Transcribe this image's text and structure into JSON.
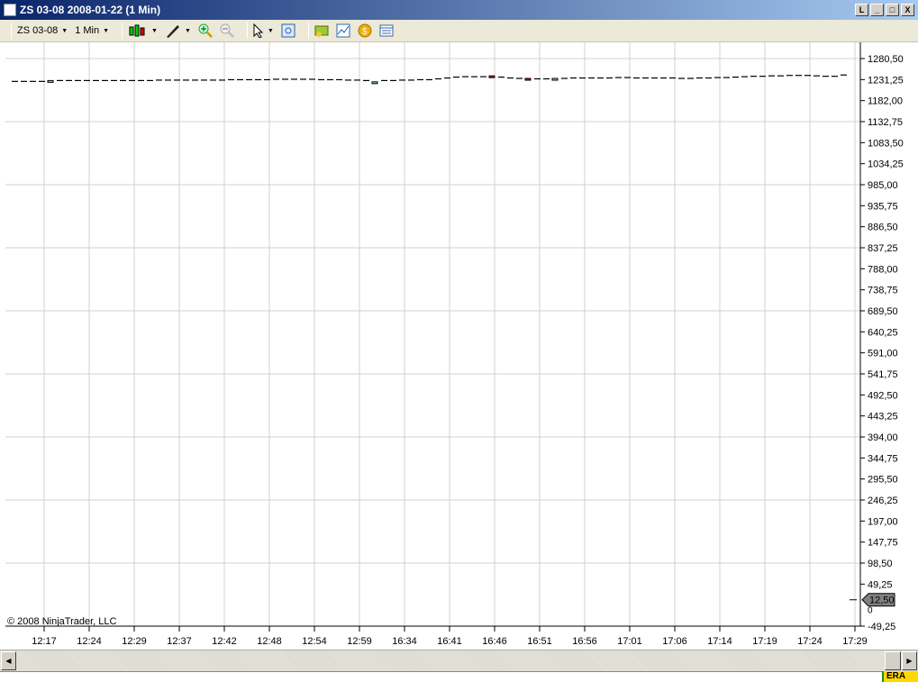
{
  "window": {
    "title": "ZS 03-08  2008-01-22  (1 Min)",
    "buttons": [
      "L",
      "_",
      "□",
      "X"
    ]
  },
  "toolbar": {
    "instrument": "ZS 03-08",
    "interval": "1 Min",
    "icons": [
      "chart-style-icon",
      "drawing-tool-icon",
      "zoom-in-icon",
      "zoom-out-icon",
      "pointer-icon",
      "data-box-icon",
      "indicators-icon",
      "strategies-icon",
      "orders-icon",
      "properties-icon"
    ]
  },
  "chart_data": {
    "type": "candlestick",
    "instrument": "ZS 03-08",
    "ylim": [
      -49.25,
      1280.5
    ],
    "y_ticks": [
      "1280,50",
      "1231,25",
      "1182,00",
      "1132,75",
      "1083,50",
      "1034,25",
      "985,00",
      "935,75",
      "886,50",
      "837,25",
      "788,00",
      "738,75",
      "689,50",
      "640,25",
      "591,00",
      "541,75",
      "492,50",
      "443,25",
      "394,00",
      "344,75",
      "295,50",
      "246,25",
      "197,00",
      "147,75",
      "98,50",
      "49,25",
      "0",
      "-49,25"
    ],
    "x_ticks": [
      "12:17",
      "12:24",
      "12:29",
      "12:37",
      "12:42",
      "12:48",
      "12:54",
      "12:59",
      "16:34",
      "16:41",
      "16:46",
      "16:51",
      "16:56",
      "17:01",
      "17:06",
      "17:14",
      "17:19",
      "17:24",
      "17:29"
    ],
    "closes": [
      1227,
      1227,
      1227,
      1227,
      1229,
      1229,
      1229,
      1229,
      1229,
      1229,
      1229,
      1229,
      1229,
      1229,
      1229,
      1229,
      1230,
      1230,
      1230,
      1230,
      1230,
      1230,
      1230,
      1230,
      1231,
      1231,
      1231,
      1231,
      1231,
      1232,
      1232,
      1232,
      1232,
      1232,
      1231,
      1231,
      1231,
      1230,
      1230,
      1229,
      1226,
      1229,
      1229,
      1230,
      1230,
      1231,
      1231,
      1233,
      1235,
      1237,
      1238,
      1238,
      1238,
      1238,
      1237,
      1235,
      1234,
      1234,
      1233,
      1233,
      1234,
      1234,
      1235,
      1235,
      1235,
      1235,
      1235,
      1236,
      1236,
      1235,
      1235,
      1235,
      1235,
      1235,
      1234,
      1234,
      1235,
      1235,
      1236,
      1236,
      1237,
      1238,
      1239,
      1239,
      1240,
      1240,
      1241,
      1241,
      1241,
      1240,
      1239,
      1239,
      1242
    ],
    "bodies": [
      {
        "index": 4,
        "open": 1227,
        "close": 1229
      },
      {
        "index": 40,
        "open": 1223,
        "close": 1226
      },
      {
        "index": 53,
        "open": 1240,
        "close": 1237
      },
      {
        "index": 57,
        "open": 1234,
        "close": 1232
      },
      {
        "index": 60,
        "open": 1233,
        "close": 1234
      }
    ],
    "marker_label": "12,50",
    "marker_value": 12.5,
    "grid": true,
    "colors": {
      "up": "#90ee90",
      "down": "#ff0000",
      "doji": "#000000",
      "grid": "#d4d0c8"
    }
  },
  "copyright": "© 2008 NinjaTrader, LLC",
  "taskbar": {
    "label": "ERA"
  }
}
